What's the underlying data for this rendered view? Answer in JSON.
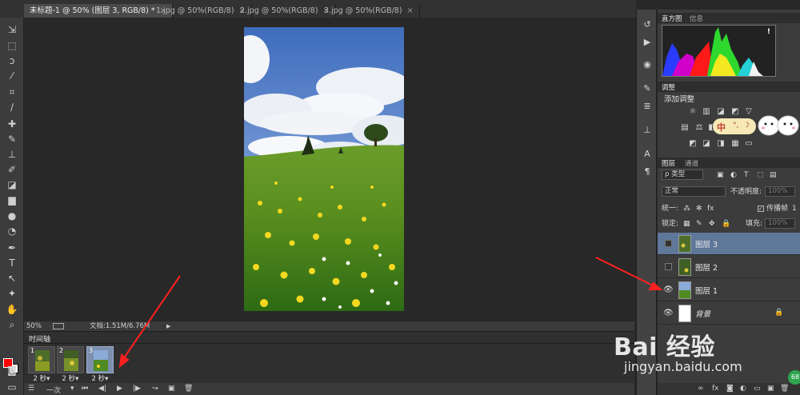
{
  "tabs": [
    {
      "title": "未标题-1 @ 50% (图层 3, RGB/8) *",
      "close": "×"
    },
    {
      "title": "1.jpg @ 50%(RGB/8)",
      "close": "×"
    },
    {
      "title": "2.jpg @ 50%(RGB/8)",
      "close": "×"
    },
    {
      "title": "3.jpg @ 50%(RGB/8)",
      "close": "×"
    }
  ],
  "toolbar": {
    "tools": [
      "move-icon",
      "marquee-icon",
      "lasso-icon",
      "magic-wand-icon",
      "crop-icon",
      "eyedropper-icon",
      "healing-icon",
      "brush-icon",
      "clone-stamp-icon",
      "history-brush-icon",
      "eraser-icon",
      "gradient-icon",
      "blur-icon",
      "dodge-icon",
      "pen-icon",
      "type-icon",
      "path-select-icon",
      "shape-icon",
      "hand-icon",
      "zoom-icon"
    ],
    "colors": {
      "foreground": "#ff0000",
      "background": "#ffffff"
    }
  },
  "statusbar": {
    "zoom": "50%",
    "doc_info": "文档:1.51M/6.76M",
    "arrow": "▶"
  },
  "timeline": {
    "title": "时间轴",
    "frames": [
      {
        "num": "1",
        "delay": "2 秒▾",
        "selected": false
      },
      {
        "num": "2",
        "delay": "2 秒▾",
        "selected": false
      },
      {
        "num": "3",
        "delay": "2 秒▾",
        "selected": true
      }
    ],
    "loop": "一次",
    "controls": {
      "first": "⏮",
      "prev": "◀|",
      "play": "▶",
      "next": "|▶",
      "tween": "tween-icon",
      "new_frame": "new-frame-icon",
      "delete": "delete-icon"
    }
  },
  "panels": {
    "histogram": {
      "tab1": "直方图",
      "tab2": "信息",
      "warning": "!"
    },
    "adjustments": {
      "tab": "调整",
      "title": "添加调整"
    },
    "ime": {
      "char": "中",
      "r1": "°,",
      "r2": "☽"
    },
    "layers": {
      "tab1": "图层",
      "tab2": "通道",
      "filter": "ρ 类型",
      "blend": "正常",
      "opacity_label": "不透明度:",
      "opacity_value": "100%",
      "unify_label": "统一:",
      "propagate_label": "传播帧",
      "propagate_value": "1",
      "lock_label": "锁定:",
      "fill_label": "填充:",
      "fill_value": "100%",
      "items": [
        {
          "name": "图层 3",
          "visible": false,
          "selected": true
        },
        {
          "name": "图层 2",
          "visible": false,
          "selected": false
        },
        {
          "name": "图层 1",
          "visible": true,
          "selected": false
        },
        {
          "name": "背景",
          "visible": true,
          "selected": false,
          "locked": true
        }
      ]
    }
  },
  "watermark": {
    "brand": "Bai 经验",
    "url": "jingyan.baidu.com",
    "badge": "68"
  },
  "colors": {
    "accent": "#5f7799",
    "annotation": "#ff2020",
    "panel": "#3c3c3c",
    "canvas": "#282828"
  }
}
